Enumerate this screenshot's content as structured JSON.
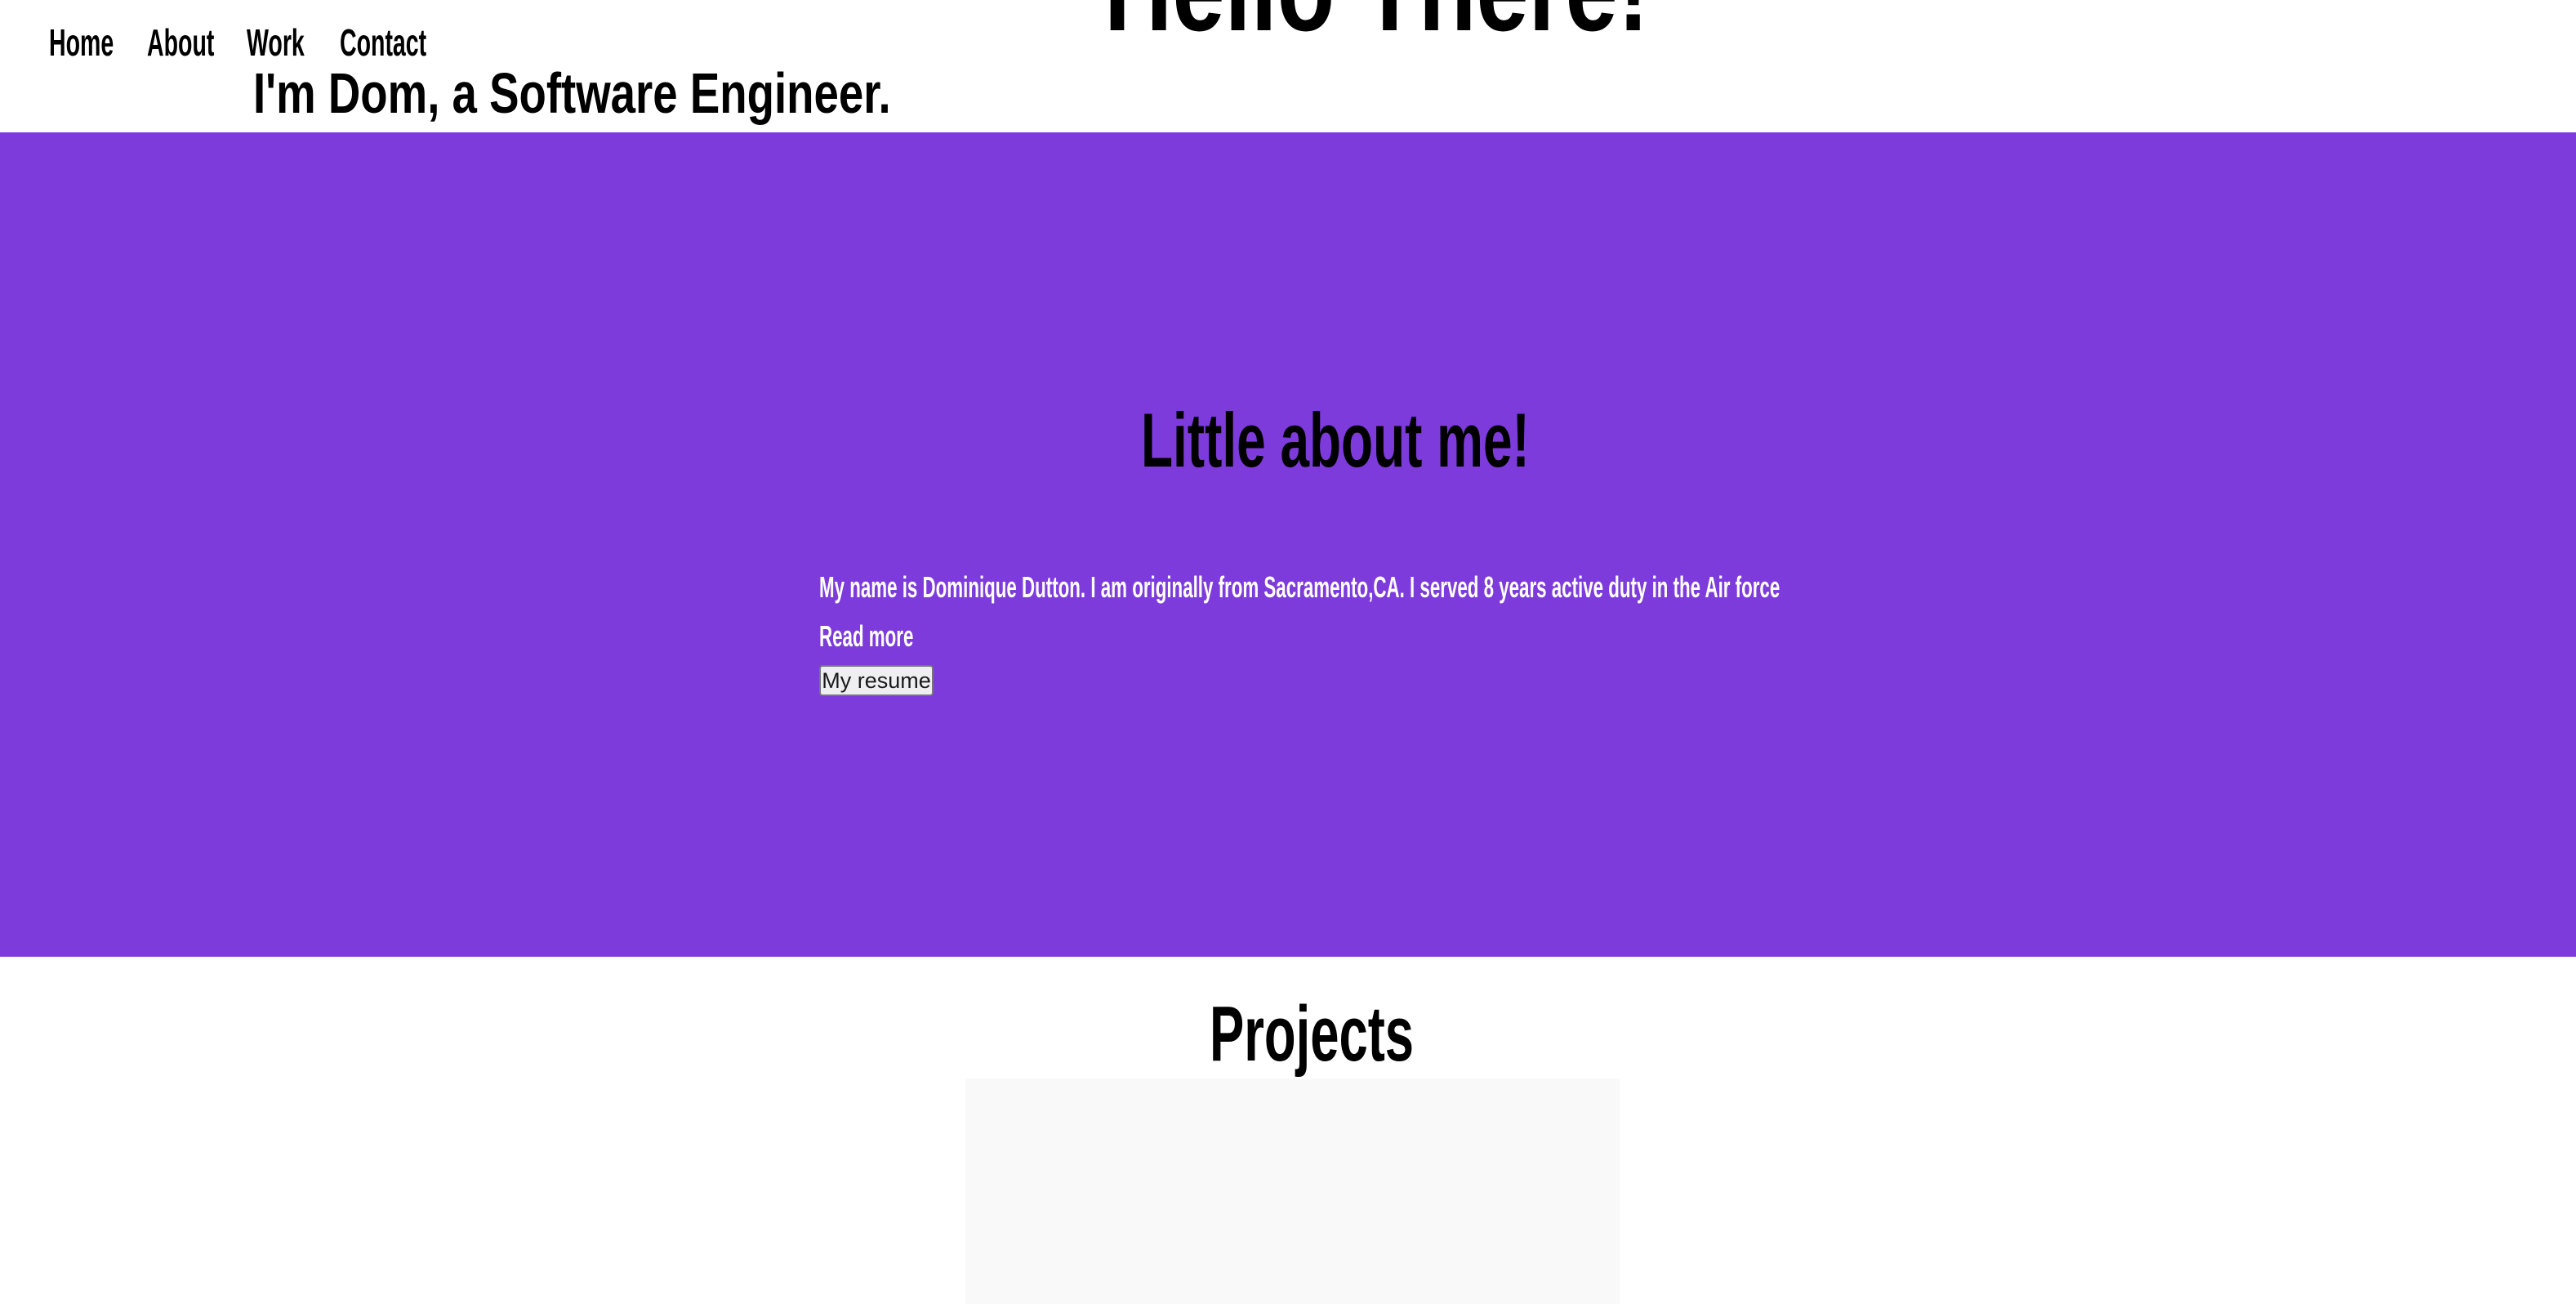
{
  "nav": {
    "items": [
      {
        "label": "Home"
      },
      {
        "label": "About"
      },
      {
        "label": "Work"
      },
      {
        "label": "Contact"
      }
    ]
  },
  "hero": {
    "title": "Hello There!",
    "subtitle": "I'm Dom, a Software Engineer."
  },
  "about": {
    "title": "Little about me!",
    "text": "My name is Dominique Dutton. I am originally from Sacramento,CA. I served 8 years active duty in the Air force",
    "read_more": "Read more",
    "resume_button": "My resume",
    "background_color": "#7d3bdb"
  },
  "projects": {
    "title": "Projects"
  }
}
